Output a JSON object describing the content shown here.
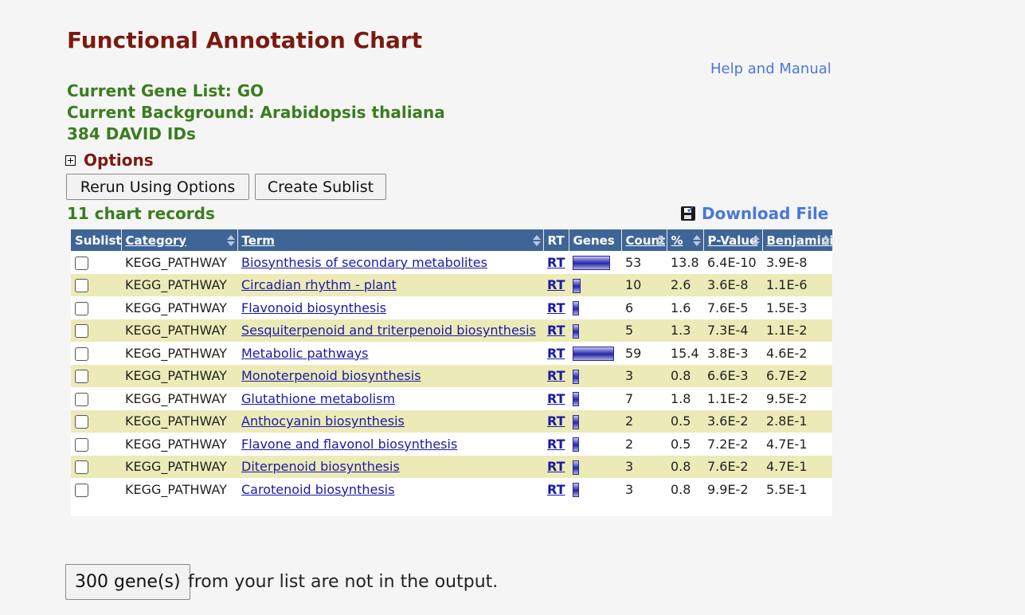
{
  "header": {
    "title": "Functional Annotation Chart",
    "help_link": "Help and Manual",
    "gene_list": "Current Gene List: GO",
    "background": "Current Background: Arabidopsis thaliana",
    "id_count": "384 DAVID IDs"
  },
  "options": {
    "label": "Options",
    "rerun_button": "Rerun Using Options",
    "sublist_button": "Create Sublist"
  },
  "records": {
    "count_label": "11 chart records",
    "download_label": "Download File"
  },
  "table": {
    "columns": [
      "Sublist",
      "Category",
      "Term",
      "RT",
      "Genes",
      "Count",
      "%",
      "P-Value",
      "Benjamini"
    ],
    "rows": [
      {
        "category": "KEGG_PATHWAY",
        "term": "Biosynthesis of secondary metabolites",
        "rt": "RT",
        "count": "53",
        "percent": "13.8",
        "pvalue": "6.4E-10",
        "benjamini": "3.9E-8"
      },
      {
        "category": "KEGG_PATHWAY",
        "term": "Circadian rhythm - plant",
        "rt": "RT",
        "count": "10",
        "percent": "2.6",
        "pvalue": "3.6E-8",
        "benjamini": "1.1E-6"
      },
      {
        "category": "KEGG_PATHWAY",
        "term": "Flavonoid biosynthesis",
        "rt": "RT",
        "count": "6",
        "percent": "1.6",
        "pvalue": "7.6E-5",
        "benjamini": "1.5E-3"
      },
      {
        "category": "KEGG_PATHWAY",
        "term": "Sesquiterpenoid and triterpenoid biosynthesis",
        "rt": "RT",
        "count": "5",
        "percent": "1.3",
        "pvalue": "7.3E-4",
        "benjamini": "1.1E-2"
      },
      {
        "category": "KEGG_PATHWAY",
        "term": "Metabolic pathways",
        "rt": "RT",
        "count": "59",
        "percent": "15.4",
        "pvalue": "3.8E-3",
        "benjamini": "4.6E-2"
      },
      {
        "category": "KEGG_PATHWAY",
        "term": "Monoterpenoid biosynthesis",
        "rt": "RT",
        "count": "3",
        "percent": "0.8",
        "pvalue": "6.6E-3",
        "benjamini": "6.7E-2"
      },
      {
        "category": "KEGG_PATHWAY",
        "term": "Glutathione metabolism",
        "rt": "RT",
        "count": "7",
        "percent": "1.8",
        "pvalue": "1.1E-2",
        "benjamini": "9.5E-2"
      },
      {
        "category": "KEGG_PATHWAY",
        "term": "Anthocyanin biosynthesis",
        "rt": "RT",
        "count": "2",
        "percent": "0.5",
        "pvalue": "3.6E-2",
        "benjamini": "2.8E-1"
      },
      {
        "category": "KEGG_PATHWAY",
        "term": "Flavone and flavonol biosynthesis",
        "rt": "RT",
        "count": "2",
        "percent": "0.5",
        "pvalue": "7.2E-2",
        "benjamini": "4.7E-1"
      },
      {
        "category": "KEGG_PATHWAY",
        "term": "Diterpenoid biosynthesis",
        "rt": "RT",
        "count": "3",
        "percent": "0.8",
        "pvalue": "7.6E-2",
        "benjamini": "4.7E-1"
      },
      {
        "category": "KEGG_PATHWAY",
        "term": "Carotenoid biosynthesis",
        "rt": "RT",
        "count": "3",
        "percent": "0.8",
        "pvalue": "9.9E-2",
        "benjamini": "5.5E-1"
      }
    ]
  },
  "footer": {
    "genes_button": "300 gene(s)",
    "not_in_output": "from your list are not in the output."
  },
  "colors": {
    "title": "#7a1a0f",
    "info": "#3a7d1f",
    "link": "#4a78d6",
    "table_header": "#3f6596",
    "alt_row": "#ecebb8"
  }
}
